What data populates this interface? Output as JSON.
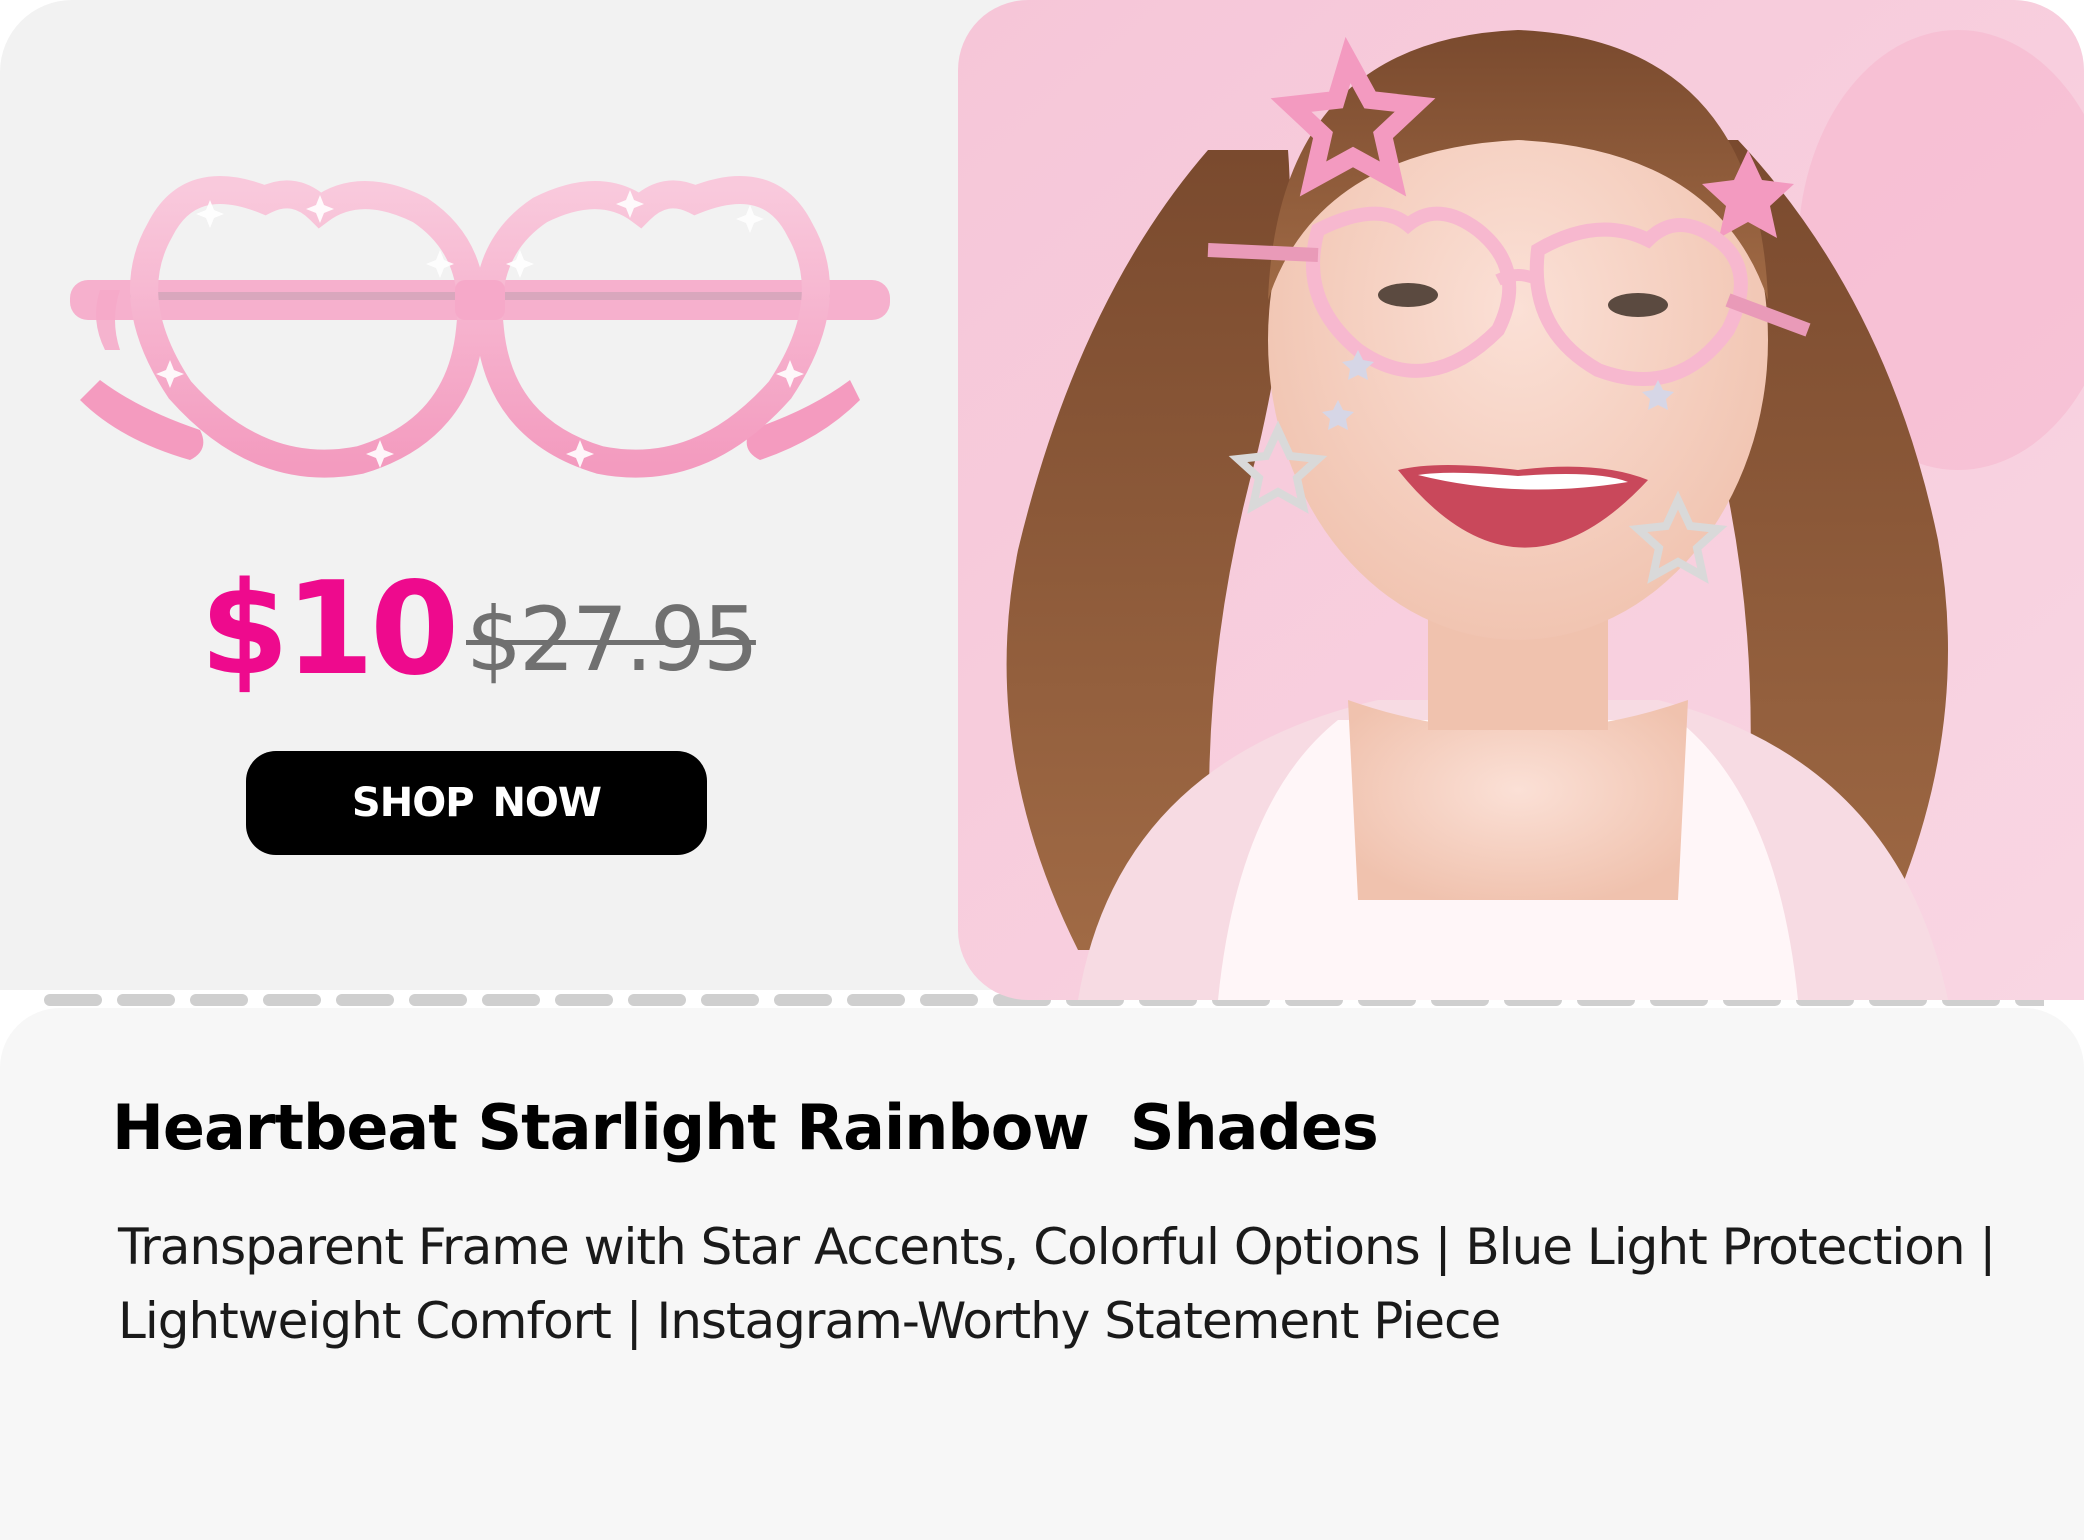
{
  "product": {
    "sale_price": "$10",
    "original_price": "$27.95",
    "cta_label": "SHOP  NOW",
    "title": "Heartbeat Starlight Rainbow  Shades",
    "description": "Transparent Frame with Star Accents, Colorful Options  | Blue Light Protection | Lightweight Comfort | Instagram-Worthy Statement Piece"
  },
  "colors": {
    "sale_price": "#ee0a8d",
    "original_price": "#707070",
    "button_bg": "#000000",
    "button_text": "#ffffff",
    "panel_top": "#f2f2f2",
    "panel_bottom": "#f7f7f7",
    "frame_pink": "#f7a8c8"
  },
  "icons": {
    "product_image": "heart-glasses-image",
    "model_photo": "model-photo"
  }
}
